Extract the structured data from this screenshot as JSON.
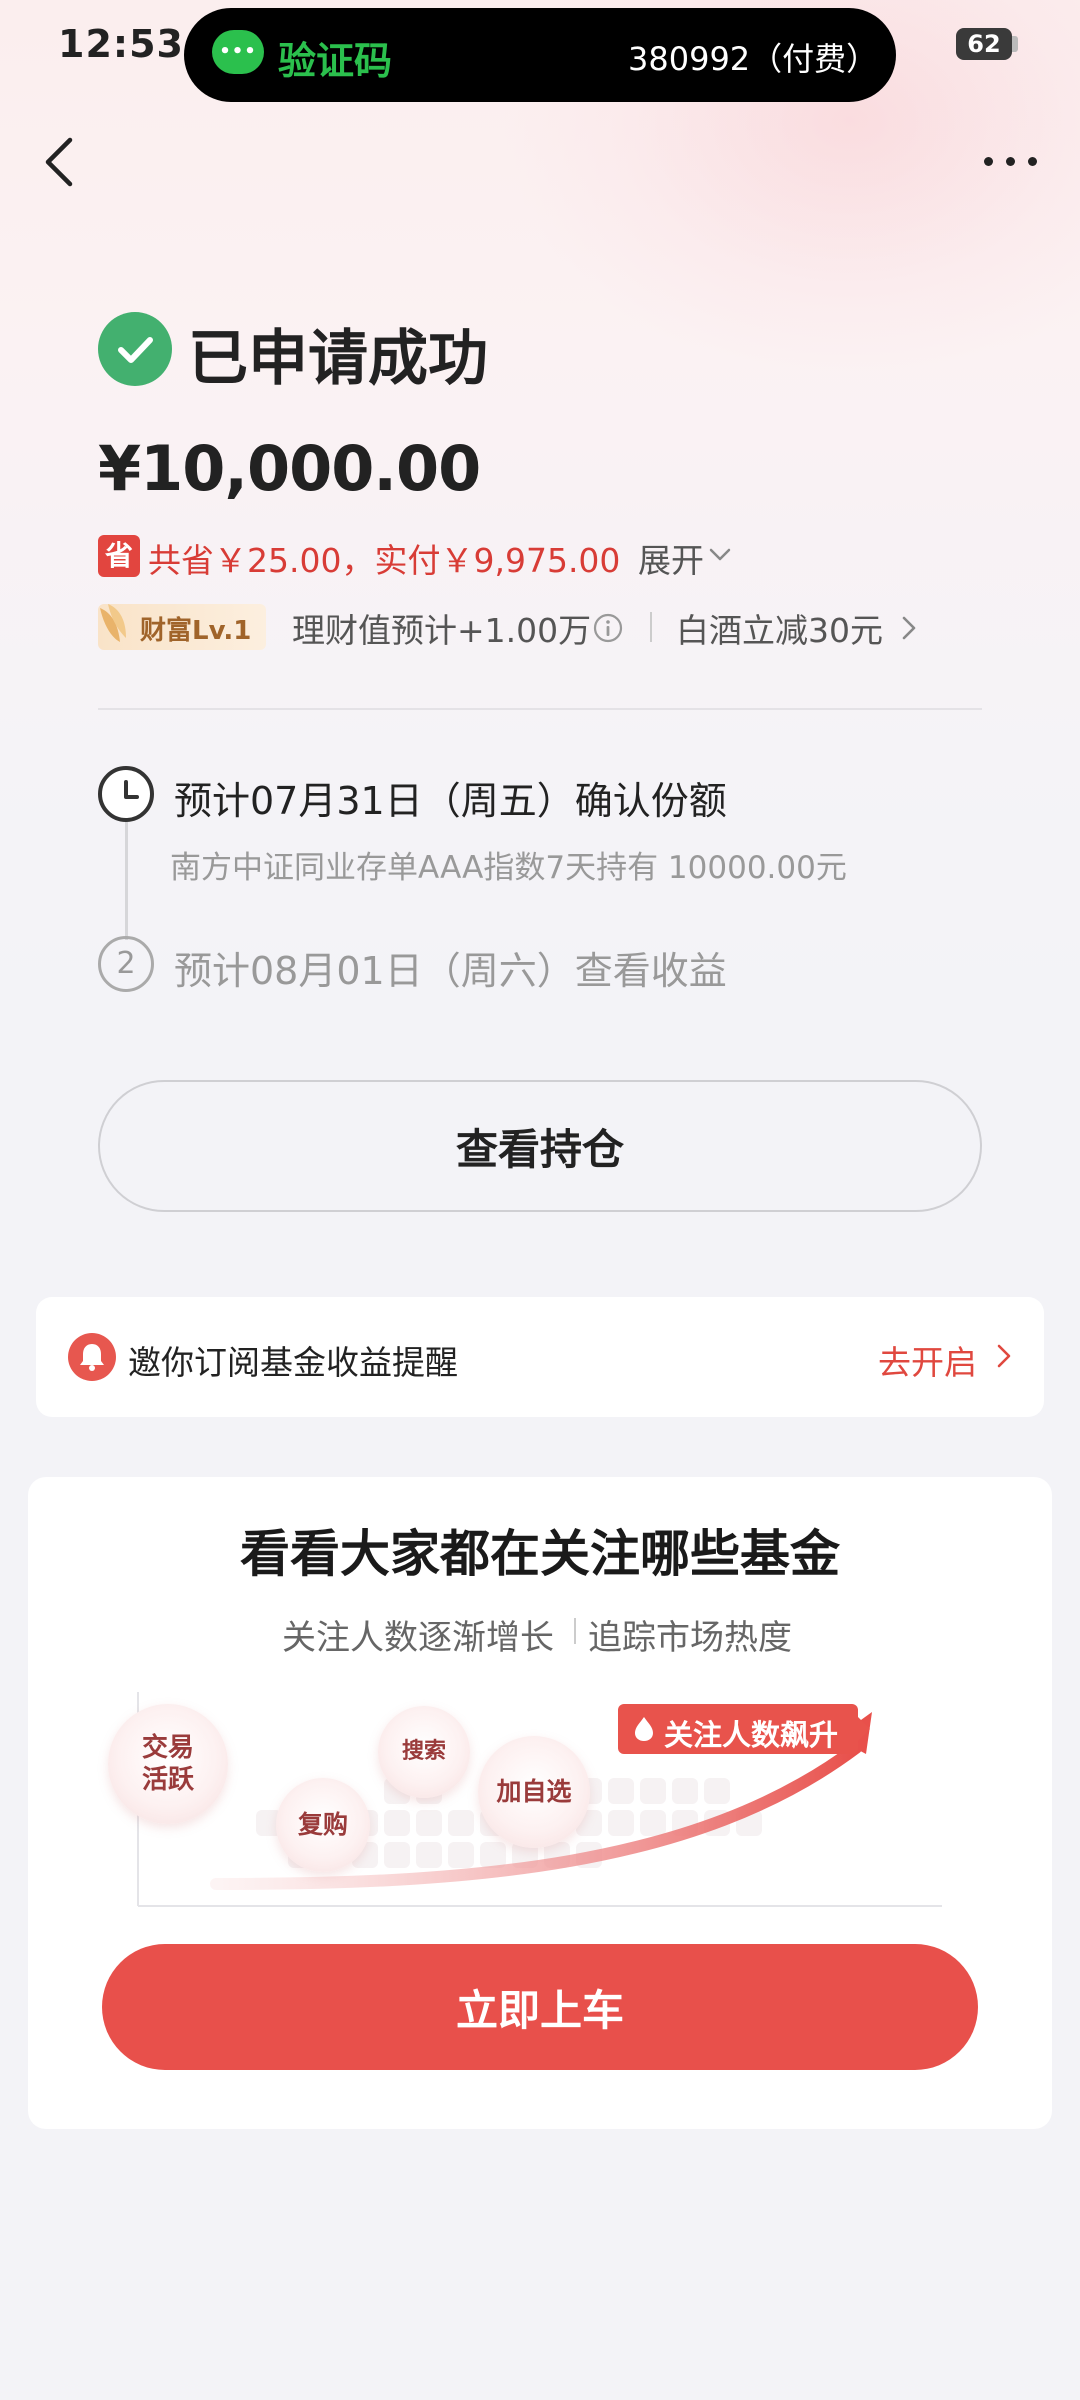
{
  "status_bar": {
    "time": "12:53",
    "battery": "62"
  },
  "notification": {
    "app_icon": "wechat-icon",
    "title": "验证码",
    "content": "380992（付费）"
  },
  "nav": {
    "back_icon": "chevron-left-icon",
    "more_icon": "more-dots-icon"
  },
  "result": {
    "status_icon": "check-circle-icon",
    "title": "已申请成功",
    "amount": "¥10,000.00",
    "save_badge": "省",
    "save_text": "共省￥25.00，实付￥9,975.00",
    "expand_label": "展开"
  },
  "wealth": {
    "level_badge": "财富Lv.1",
    "value_text": "理财值预计+1.00万",
    "promo_text": "白酒立减30元"
  },
  "timeline": {
    "steps": [
      {
        "index": "",
        "title": "预计07月31日（周五）确认份额",
        "subtitle": "南方中证同业存单AAA指数7天持有 10000.00元"
      },
      {
        "index": "2",
        "title": "预计08月01日（周六）查看收益"
      }
    ]
  },
  "actions": {
    "view_holdings": "查看持仓"
  },
  "reminder": {
    "text": "邀你订阅基金收益提醒",
    "action": "去开启"
  },
  "promo": {
    "title": "看看大家都在关注哪些基金",
    "subtitle_left": "关注人数逐渐增长",
    "subtitle_right": "追踪市场热度",
    "bubbles": [
      "交易活跃",
      "复购",
      "搜索",
      "加自选"
    ],
    "bubble_line1": "交易",
    "bubble_line2": "活跃",
    "hot_tag": "关注人数飙升",
    "cta": "立即上车"
  },
  "colors": {
    "accent_red": "#e8504b",
    "success_green": "#43b06f",
    "wechat_green": "#2bc04d"
  }
}
